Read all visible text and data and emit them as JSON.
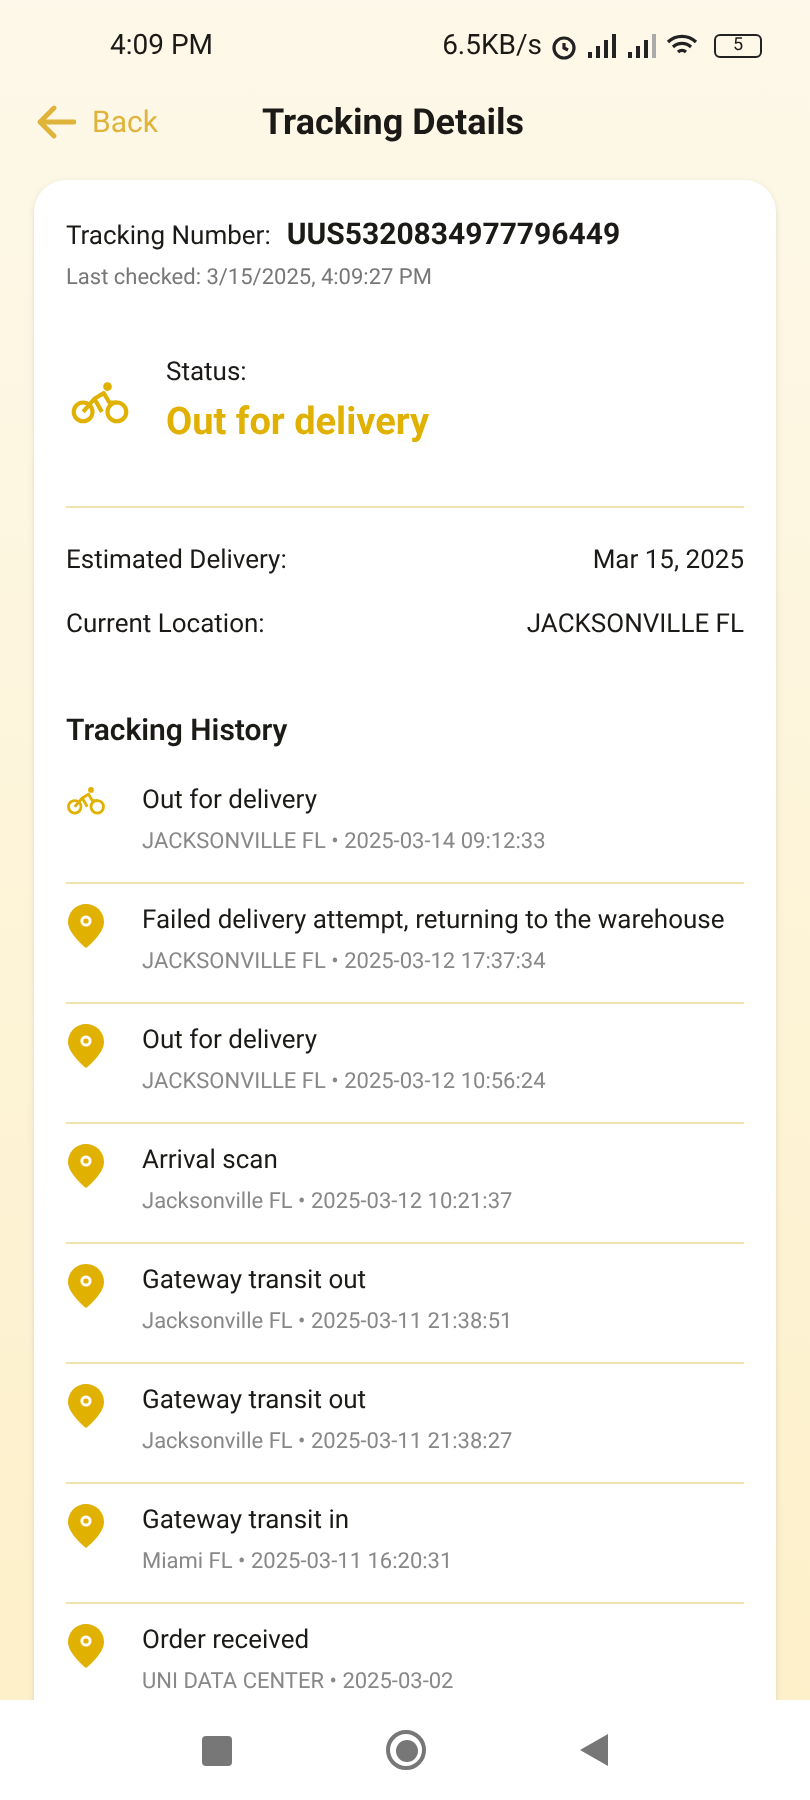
{
  "status_bar": {
    "time": "4:09 PM",
    "speed": "6.5KB/s",
    "battery": "5"
  },
  "header": {
    "back": "Back",
    "title": "Tracking Details"
  },
  "summary": {
    "tracking_label": "Tracking Number:",
    "tracking_number": "UUS5320834977796449",
    "last_checked": "Last checked: 3/15/2025, 4:09:27 PM",
    "status_label": "Status:",
    "status": "Out for delivery",
    "estimated_label": "Estimated Delivery:",
    "estimated": "Mar 15, 2025",
    "location_label": "Current Location:",
    "location": "JACKSONVILLE FL"
  },
  "history": {
    "title": "Tracking History",
    "events": [
      {
        "kind": "bike",
        "title": "Out for delivery",
        "detail": "JACKSONVILLE FL • 2025-03-14 09:12:33"
      },
      {
        "kind": "pin",
        "title": "Failed delivery attempt, returning to the warehouse",
        "detail": "JACKSONVILLE FL • 2025-03-12 17:37:34"
      },
      {
        "kind": "pin",
        "title": "Out for delivery",
        "detail": "JACKSONVILLE FL • 2025-03-12 10:56:24"
      },
      {
        "kind": "pin",
        "title": "Arrival scan",
        "detail": "Jacksonville FL • 2025-03-12 10:21:37"
      },
      {
        "kind": "pin",
        "title": "Gateway transit out",
        "detail": "Jacksonville FL • 2025-03-11 21:38:51"
      },
      {
        "kind": "pin",
        "title": "Gateway transit out",
        "detail": "Jacksonville FL • 2025-03-11 21:38:27"
      },
      {
        "kind": "pin",
        "title": "Gateway transit in",
        "detail": "Miami FL • 2025-03-11 16:20:31"
      },
      {
        "kind": "pin",
        "title": "Order received",
        "detail": "UNI DATA CENTER • 2025-03-02"
      }
    ]
  }
}
